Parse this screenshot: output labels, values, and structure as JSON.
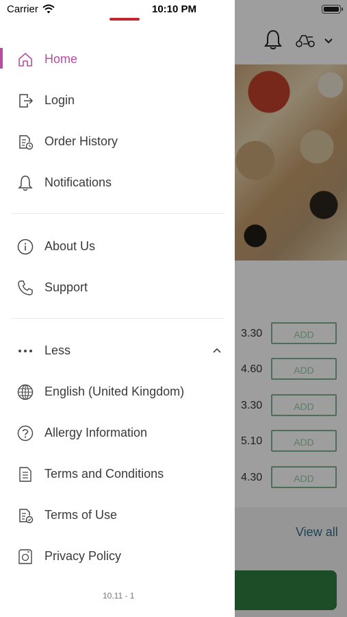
{
  "status_bar": {
    "carrier": "Carrier",
    "time": "10:10 PM"
  },
  "drawer": {
    "menu_items": [
      {
        "label": "Home",
        "icon": "home-icon",
        "active": true
      },
      {
        "label": "Login",
        "icon": "login-icon"
      },
      {
        "label": "Order History",
        "icon": "order-history-icon"
      },
      {
        "label": "Notifications",
        "icon": "bell-icon"
      },
      {
        "label": "About Us",
        "icon": "info-icon"
      },
      {
        "label": "Support",
        "icon": "phone-icon"
      },
      {
        "label": "Less",
        "icon": "more-dots-icon"
      },
      {
        "label": "English (United Kingdom)",
        "icon": "globe-icon"
      },
      {
        "label": "Allergy Information",
        "icon": "question-icon"
      },
      {
        "label": "Terms and Conditions",
        "icon": "document-icon"
      },
      {
        "label": "Terms of Use",
        "icon": "document-check-icon"
      },
      {
        "label": "Privacy Policy",
        "icon": "privacy-icon"
      }
    ],
    "version": "10.11 - 1",
    "accent_color": "#b84ca0"
  },
  "background": {
    "prices": [
      "3.30",
      "4.60",
      "3.30",
      "5.10",
      "4.30"
    ],
    "add_label": "ADD",
    "view_all": "View all"
  }
}
